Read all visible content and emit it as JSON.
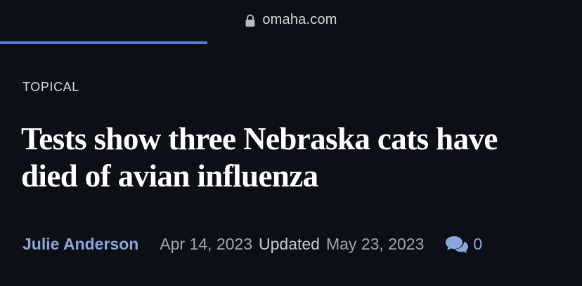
{
  "browser": {
    "url": "omaha.com",
    "lock_icon": "lock-icon",
    "load_progress": 0.356,
    "accent_color": "#4f7fd8"
  },
  "article": {
    "section": "TOPICAL",
    "headline": "Tests show three Nebraska cats have died of avian influenza",
    "author": "Julie Anderson",
    "published_date": "Apr 14, 2023",
    "updated_label": "Updated",
    "updated_date": "May 23, 2023",
    "comment_icon": "chat-bubbles-icon",
    "comment_count": "0",
    "link_color": "#8ca6dc"
  }
}
